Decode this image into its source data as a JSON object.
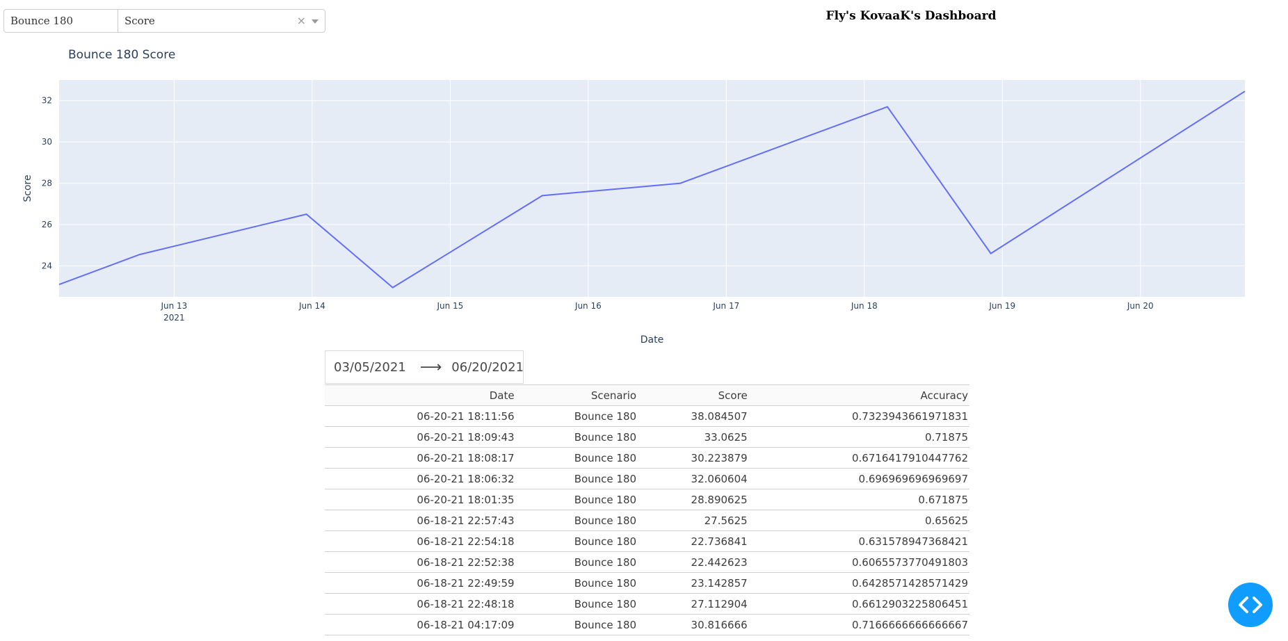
{
  "header": {
    "title": "Fly's KovaaK's Dashboard"
  },
  "controls": {
    "scenario_value": "Bounce 180",
    "metric_value": "Score",
    "clear_glyph": "×"
  },
  "date_range": {
    "start": "03/05/2021",
    "end": "06/20/2021",
    "arrow": "⟶"
  },
  "chart_data": {
    "type": "line",
    "title": "Bounce 180 Score",
    "xlabel": "Date",
    "ylabel": "Score",
    "x": [
      "2021-06-12 04:00",
      "2021-06-12 18:00",
      "2021-06-13 23:00",
      "2021-06-14 14:00",
      "2021-06-15 16:00",
      "2021-06-16 16:00",
      "2021-06-18 04:00",
      "2021-06-18 22:00",
      "2021-06-20 18:10"
    ],
    "y": [
      23.1,
      24.55,
      26.5,
      22.95,
      27.4,
      28.0,
      31.7,
      24.6,
      32.45
    ],
    "xlim": [
      "2021-06-12 04:00",
      "2021-06-20 18:10"
    ],
    "ylim": [
      22.5,
      33.0
    ],
    "x_ticks": [
      {
        "label": "Jun 13",
        "sub": "2021",
        "at": "2021-06-13 00:00"
      },
      {
        "label": "Jun 14",
        "sub": "",
        "at": "2021-06-14 00:00"
      },
      {
        "label": "Jun 15",
        "sub": "",
        "at": "2021-06-15 00:00"
      },
      {
        "label": "Jun 16",
        "sub": "",
        "at": "2021-06-16 00:00"
      },
      {
        "label": "Jun 17",
        "sub": "",
        "at": "2021-06-17 00:00"
      },
      {
        "label": "Jun 18",
        "sub": "",
        "at": "2021-06-18 00:00"
      },
      {
        "label": "Jun 19",
        "sub": "",
        "at": "2021-06-19 00:00"
      },
      {
        "label": "Jun 20",
        "sub": "",
        "at": "2021-06-20 00:00"
      }
    ],
    "y_ticks": [
      24,
      26,
      28,
      30,
      32
    ],
    "grid": true,
    "colors": {
      "line": "#636efa",
      "plot_bg": "#e5ecf6",
      "grid": "#ffffff",
      "text": "#2a3f5f"
    }
  },
  "table": {
    "headers": [
      "Date",
      "Scenario",
      "Score",
      "Accuracy"
    ],
    "rows": [
      [
        "06-20-21 18:11:56",
        "Bounce 180",
        "38.084507",
        "0.7323943661971831"
      ],
      [
        "06-20-21 18:09:43",
        "Bounce 180",
        "33.0625",
        "0.71875"
      ],
      [
        "06-20-21 18:08:17",
        "Bounce 180",
        "30.223879",
        "0.6716417910447762"
      ],
      [
        "06-20-21 18:06:32",
        "Bounce 180",
        "32.060604",
        "0.696969696969697"
      ],
      [
        "06-20-21 18:01:35",
        "Bounce 180",
        "28.890625",
        "0.671875"
      ],
      [
        "06-18-21 22:57:43",
        "Bounce 180",
        "27.5625",
        "0.65625"
      ],
      [
        "06-18-21 22:54:18",
        "Bounce 180",
        "22.736841",
        "0.631578947368421"
      ],
      [
        "06-18-21 22:52:38",
        "Bounce 180",
        "22.442623",
        "0.6065573770491803"
      ],
      [
        "06-18-21 22:49:59",
        "Bounce 180",
        "23.142857",
        "0.6428571428571429"
      ],
      [
        "06-18-21 22:48:18",
        "Bounce 180",
        "27.112904",
        "0.6612903225806451"
      ],
      [
        "06-18-21 04:17:09",
        "Bounce 180",
        "30.816666",
        "0.7166666666666667"
      ]
    ]
  },
  "icons": {
    "code_toggle": "code-toggle-icon"
  },
  "colors": {
    "accent": "#119DFF"
  }
}
